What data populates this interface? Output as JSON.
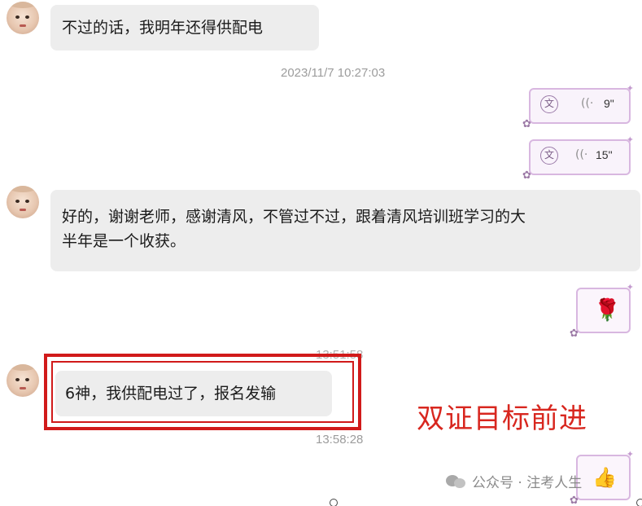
{
  "messages": {
    "m1": "不过的话，我明年还得供配电",
    "m2_line1": "好的，谢谢老师，感谢清风，不管过不过，跟着清风培训班学习的大",
    "m2_line2": "半年是一个收获。",
    "m3": "6神，我供配电过了，报名发输"
  },
  "timestamps": {
    "t1": "2023/11/7 10:27:03",
    "t2": "13:51:58",
    "t3": "13:58:28"
  },
  "voice_messages": [
    {
      "translate_icon_label": "文",
      "wave": "((·",
      "duration": "9\""
    },
    {
      "translate_icon_label": "文",
      "wave": "((·",
      "duration": "15\""
    }
  ],
  "stickers": {
    "rose": "🌹",
    "thumbs_up": "👍"
  },
  "overlay_caption": "双证目标前进",
  "watermark": "公众号 · 注考人生",
  "icons": {
    "sticker_corner": "✦",
    "voice_flower": "✿"
  },
  "colors": {
    "highlight_red": "#d11a1a",
    "caption_red": "#d8271f",
    "incoming_bubble": "#ededed",
    "voice_border": "#d8b7e0"
  }
}
